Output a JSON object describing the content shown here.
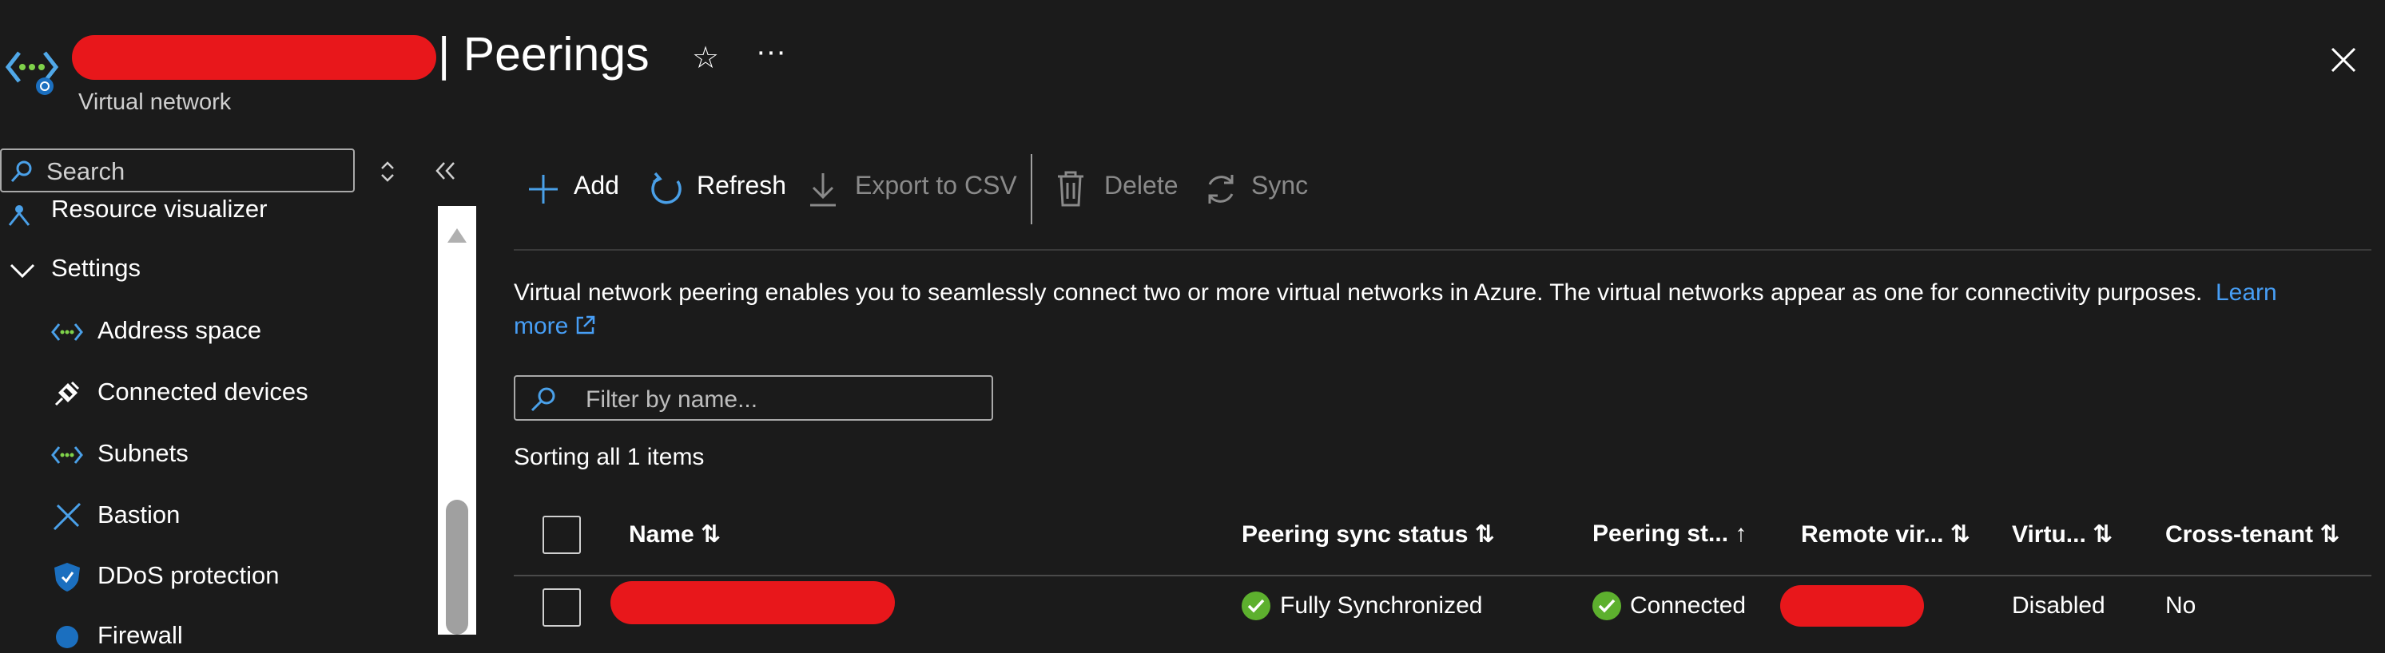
{
  "header": {
    "title": "| Peerings",
    "subtitle": "Virtual network"
  },
  "sidebar": {
    "search_placeholder": "Search",
    "items": [
      {
        "label": "Resource visualizer",
        "icon": "resource-visualizer-icon"
      },
      {
        "label": "Settings",
        "icon": "chevron-down-icon"
      },
      {
        "label": "Address space",
        "icon": "vnet-icon"
      },
      {
        "label": "Connected devices",
        "icon": "plug-icon"
      },
      {
        "label": "Subnets",
        "icon": "vnet-icon"
      },
      {
        "label": "Bastion",
        "icon": "bastion-icon"
      },
      {
        "label": "DDoS protection",
        "icon": "shield-icon"
      },
      {
        "label": "Firewall",
        "icon": "firewall-icon"
      }
    ]
  },
  "toolbar": {
    "add_label": "Add",
    "refresh_label": "Refresh",
    "export_label": "Export to CSV",
    "delete_label": "Delete",
    "sync_label": "Sync"
  },
  "main": {
    "description": "Virtual network peering enables you to seamlessly connect two or more virtual networks in Azure. The virtual networks appear as one for connectivity purposes.",
    "learn_more_1": "Learn",
    "learn_more_2": "more",
    "filter_placeholder": "Filter by name...",
    "sorting_text": "Sorting all 1 items"
  },
  "table": {
    "columns": [
      "Name ⇅",
      "Peering sync status ⇅",
      "Peering st... ↑",
      "Remote vir... ⇅",
      "Virtu... ⇅",
      "Cross-tenant ⇅"
    ],
    "rows": [
      {
        "sync_status": "Fully Synchronized",
        "peering_state": "Connected",
        "virtual_network_access": "Disabled",
        "cross_tenant": "No"
      }
    ]
  },
  "colors": {
    "background": "#1b1b1b",
    "accent": "#479ef5",
    "redaction": "#e8171b",
    "success": "#5db02e"
  }
}
